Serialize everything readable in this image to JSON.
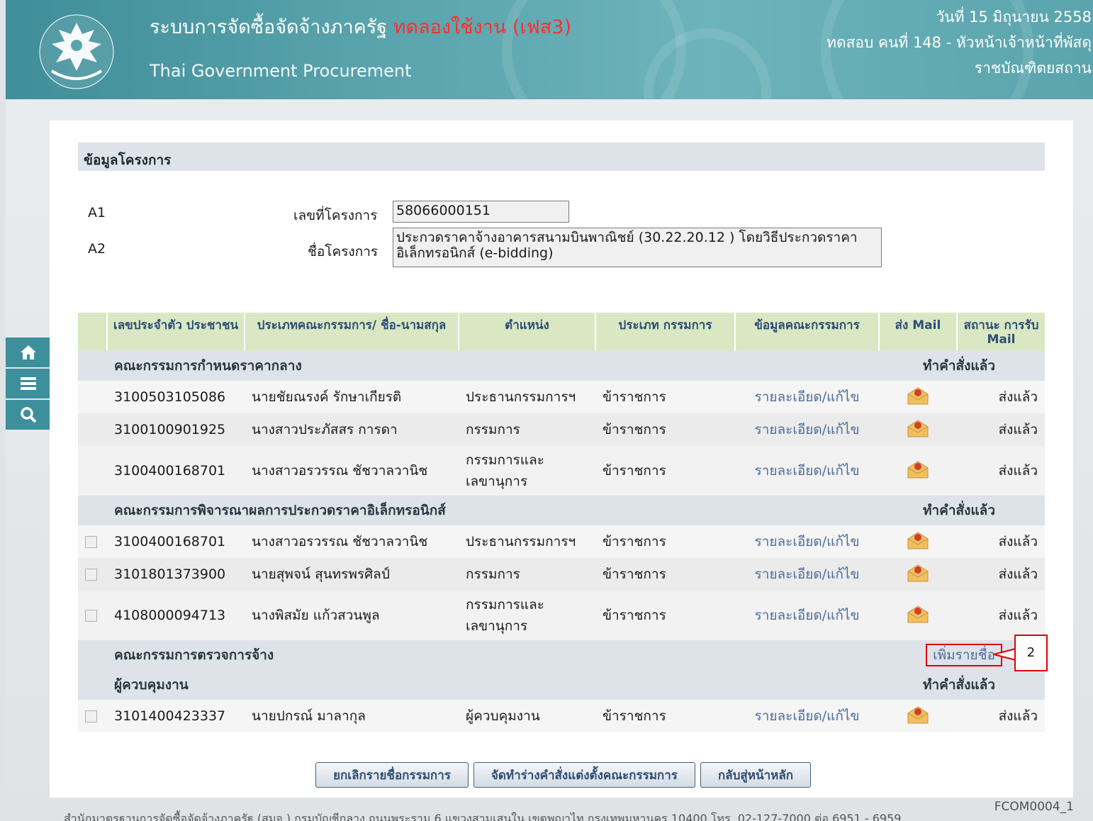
{
  "header": {
    "title": "ระบบการจัดซื้อจัดจ้างภาครัฐ",
    "title_trial": "ทดลองใช้งาน (เฟส3)",
    "subtitle": "Thai Government Procurement",
    "date": "วันที่ 15 มิถุนายน 2558",
    "user": "ทดสอบ คนที่ 148 - หัวหน้าเจ้าหน้าที่พัสดุ",
    "org": "ราชบัณฑิตยสถาน",
    "logo_icon": "garuda-seal-icon"
  },
  "sidebar": {
    "items": [
      "home-icon",
      "menu-icon",
      "search-icon"
    ]
  },
  "project": {
    "section_title": "ข้อมูลโครงการ",
    "fields": [
      {
        "code": "A1",
        "label": "เลขที่โครงการ",
        "value": "58066000151"
      },
      {
        "code": "A2",
        "label": "ชื่อโครงการ",
        "value": "ประกวดราคาจ้างอาคารสนามบินพาณิชย์ (30.22.20.12 ) โดยวิธีประกวดราคาอิเล็กทรอนิกส์ (e-bidding)"
      }
    ]
  },
  "table": {
    "headers": [
      "เลขประจำตัว ประชาชน",
      "ประเภทคณะกรรมการ/ ชื่อ-นามสกุล",
      "ตำแหน่ง",
      "ประเภท กรรมการ",
      "ข้อมูลคณะกรรมการ",
      "ส่ง Mail",
      "สถานะ การรับ Mail"
    ],
    "groups": [
      {
        "name": "คณะกรรมการกำหนดราคากลาง",
        "action": "ทำคำสั่งแล้ว",
        "rows": [
          {
            "id": "3100503105086",
            "name": "นายชัยณรงค์ รักษาเกียรติ",
            "position": "ประธานกรรมการฯ",
            "type": "ข้าราชการ",
            "detail": "รายละเอียด/แก้ไข",
            "status": "ส่งแล้ว"
          },
          {
            "id": "3100100901925",
            "name": "นางสาวประภัสสร การดา",
            "position": "กรรมการ",
            "type": "ข้าราชการ",
            "detail": "รายละเอียด/แก้ไข",
            "status": "ส่งแล้ว"
          },
          {
            "id": "3100400168701",
            "name": "นางสาวอรวรรณ ชัชวาลวานิช",
            "position": "กรรมการและ เลขานุการ",
            "type": "ข้าราชการ",
            "detail": "รายละเอียด/แก้ไข",
            "status": "ส่งแล้ว"
          }
        ]
      },
      {
        "name": "คณะกรรมการพิจารณาผลการประกวดราคาอิเล็กทรอนิกส์",
        "action": "ทำคำสั่งแล้ว",
        "rows": [
          {
            "id": "3100400168701",
            "name": "นางสาวอรวรรณ ชัชวาลวานิช",
            "position": "ประธานกรรมการฯ",
            "type": "ข้าราชการ",
            "detail": "รายละเอียด/แก้ไข",
            "status": "ส่งแล้ว"
          },
          {
            "id": "3101801373900",
            "name": "นายสุพจน์ สุนทรพรศิลป์",
            "position": "กรรมการ",
            "type": "ข้าราชการ",
            "detail": "รายละเอียด/แก้ไข",
            "status": "ส่งแล้ว"
          },
          {
            "id": "4108000094713",
            "name": "นางพิสมัย แก้วสวนพูล",
            "position": "กรรมการและ เลขานุการ",
            "type": "ข้าราชการ",
            "detail": "รายละเอียด/แก้ไข",
            "status": "ส่งแล้ว"
          }
        ]
      },
      {
        "name": "คณะกรรมการตรวจการจ้าง",
        "action": "เพิ่มรายชื่อ",
        "rows": []
      },
      {
        "name": "ผู้ควบคุมงาน",
        "action": "ทำคำสั่งแล้ว",
        "rows": [
          {
            "id": "3101400423337",
            "name": "นายปกรณ์ มาลากุล",
            "position": "ผู้ควบคุมงาน",
            "type": "ข้าราชการ",
            "detail": "รายละเอียด/แก้ไข",
            "status": "ส่งแล้ว"
          }
        ]
      }
    ]
  },
  "callout_number": "2",
  "buttons": {
    "cancel": "ยกเลิกรายชื่อกรรมการ",
    "draft": "จัดทำร่างคำสั่งแต่งตั้งคณะกรรมการ",
    "back": "กลับสู่หน้าหลัก"
  },
  "page_code": "FCOM0004_1",
  "footer": "สำนักมาตรฐานการจัดซื้อจัดจ้างภาครัฐ (สมจ.) กรมบัญชีกลาง ถนนพระราม 6 แขวงสามเสนใน เขตพญาไท กรุงเทพมหานคร 10400 โทร. 02-127-7000 ต่อ 6951 - 6959",
  "colors": {
    "header": "#5aa4ad",
    "accent_red": "#e00000",
    "table_header": "#d9e8c2",
    "link": "#4e6c9b"
  }
}
